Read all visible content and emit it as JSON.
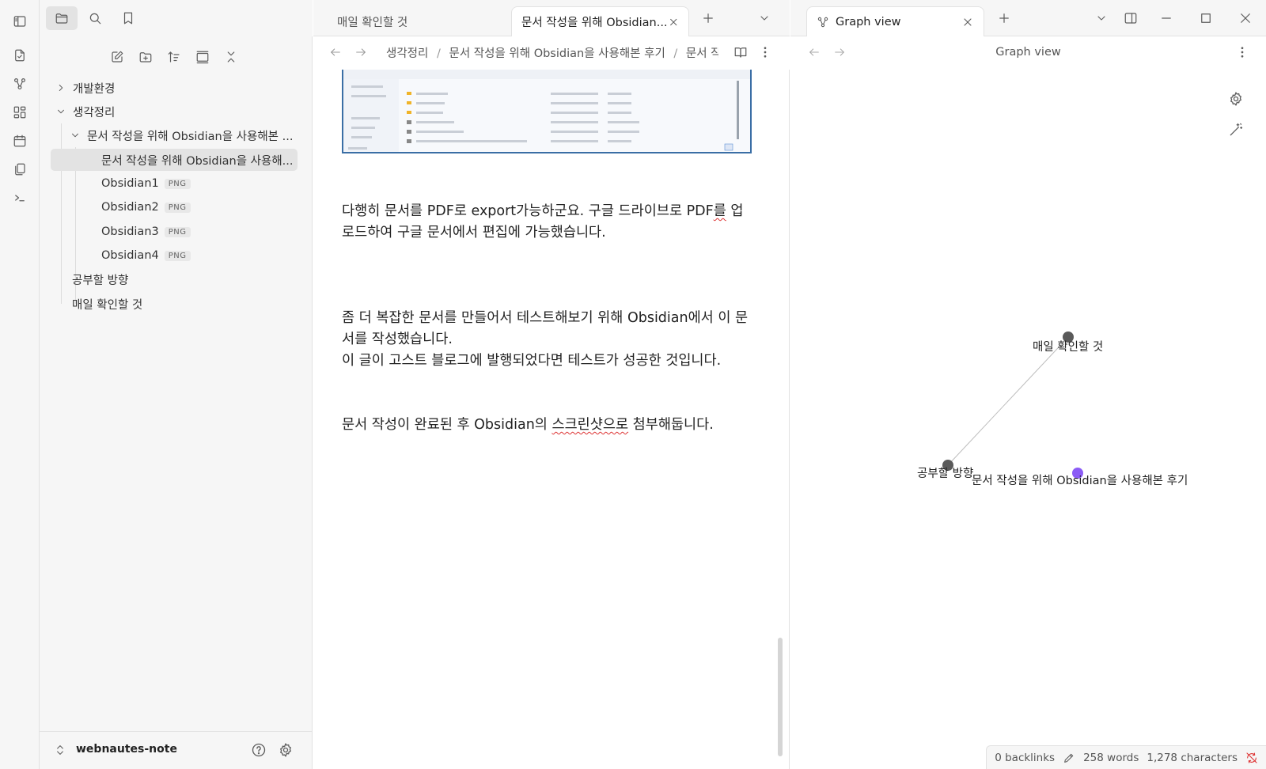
{
  "left_top": {
    "icons": [
      "sidebar-toggle-icon",
      "folder-icon",
      "search-icon",
      "bookmark-icon"
    ]
  },
  "ribbon": {
    "icons": [
      "switcher-icon",
      "graph-icon",
      "canvas-icon",
      "calendar-icon",
      "templates-icon",
      "terminal-icon"
    ]
  },
  "file_tree": {
    "items": [
      {
        "label": "개발환경",
        "expanded": false
      },
      {
        "label": "생각정리",
        "expanded": true
      },
      {
        "label": "문서 작성을 위해 Obsidian을 사용해본 ...",
        "expanded": true
      },
      {
        "label": "문서 작성을 위해 Obsidian을 사용해..."
      },
      {
        "label": "Obsidian1",
        "tag": "PNG"
      },
      {
        "label": "Obsidian2",
        "tag": "PNG"
      },
      {
        "label": "Obsidian3",
        "tag": "PNG"
      },
      {
        "label": "Obsidian4",
        "tag": "PNG"
      },
      {
        "label": "공부할 방향"
      },
      {
        "label": "매일 확인할 것"
      }
    ]
  },
  "vault": {
    "name": "webnautes-note"
  },
  "editor": {
    "tabs": [
      {
        "label": "매일 확인할 것"
      },
      {
        "label": "문서 작성을 위해 Obsidian..."
      }
    ],
    "breadcrumb": [
      "생각정리",
      "/",
      "문서 작성을 위해 Obsidian을 사용해본 후기",
      "/",
      "문서 작성"
    ],
    "paragraphs": {
      "p1_a": "다행히 문서를 PDF로 export가능하군요. 구글 드라이브로 PDF",
      "p1_b": "를",
      "p1_c": " 업로드하여 구글 문서에서 편집에 가능했습니다.",
      "p2_a": "좀 더 복잡한 문서를 만들어서 테스트해보기 위해 Obsidian에서 이 문서를 작성했습니다.",
      "p2_b": "이 글이 고스트 블로그에 발행되었다면 테스트가 성공한 것입니다.",
      "p3_a": "문서 작성이 완료된 후 Obsidian의 ",
      "p3_b": "스크린샷으로",
      "p3_c": " 첨부해둡니다."
    }
  },
  "graph": {
    "tab_label": "Graph view",
    "header_title": "Graph view",
    "nodes": [
      {
        "label": "매일 확인할 것",
        "color": "#5a5a5a"
      },
      {
        "label": "공부할 방향",
        "color": "#5a5a5a"
      },
      {
        "label": "문서 작성을 위해 Obsidian을 사용해본 후기",
        "color": "#8b5cf6"
      }
    ],
    "accent_color": "#8b5cf6"
  },
  "status_bar": {
    "backlinks": "0 backlinks",
    "words": "258 words",
    "characters": "1,278 characters"
  }
}
